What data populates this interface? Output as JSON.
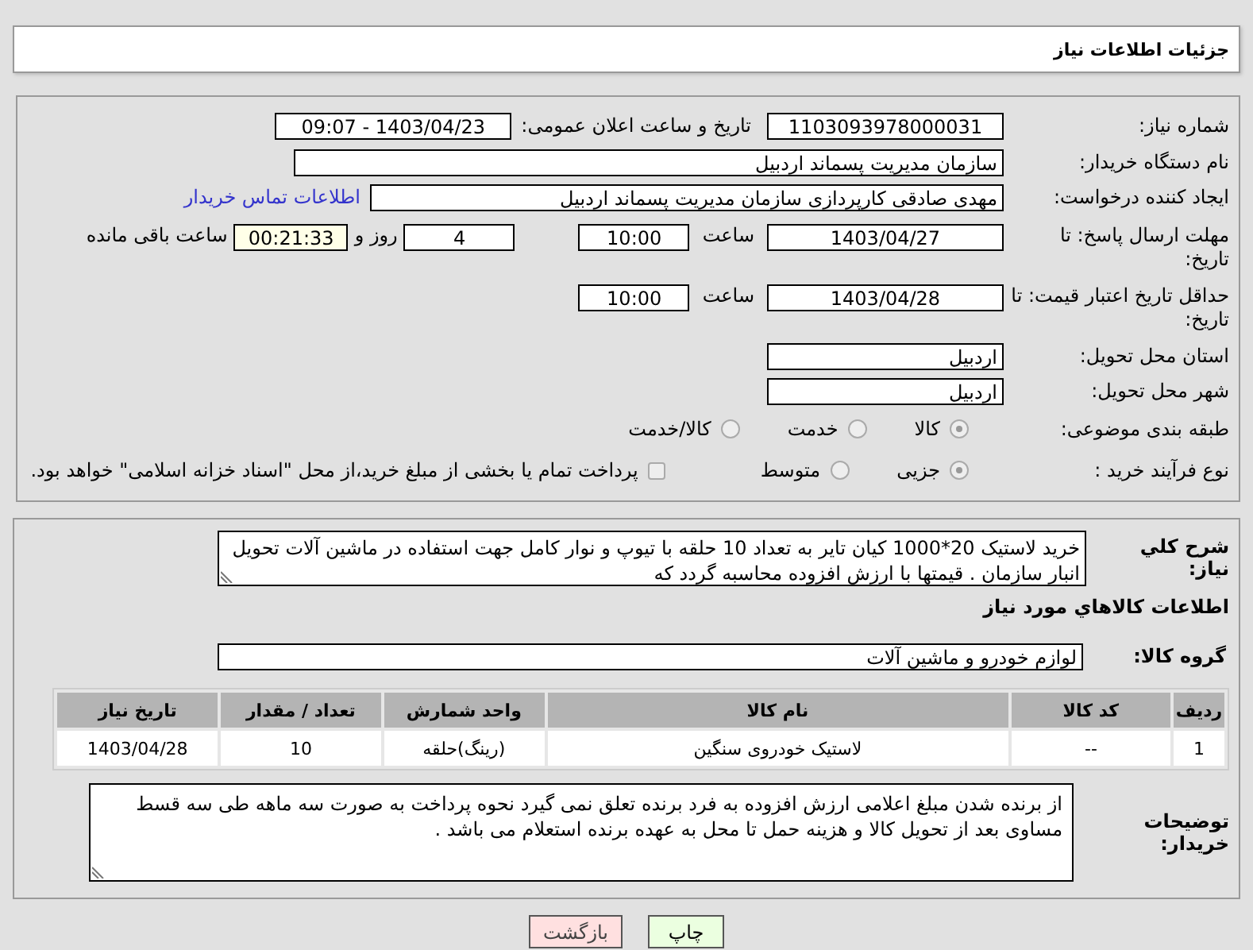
{
  "header": {
    "title": "جزئیات اطلاعات نیاز"
  },
  "need_number": {
    "label": "شماره نیاز:",
    "value": "1103093978000031"
  },
  "announce_datetime": {
    "label": "تاریخ و ساعت اعلان عمومی:",
    "value": "1403/04/23 - 09:07"
  },
  "buyer_org": {
    "label": "نام دستگاه خریدار:",
    "value": "سازمان مدیریت پسماند اردبیل"
  },
  "requester": {
    "label": "ایجاد کننده درخواست:",
    "value": "مهدی صادقی کارپردازی سازمان مدیریت پسماند اردبیل",
    "link": "اطلاعات تماس خریدار"
  },
  "response_deadline": {
    "label": "مهلت ارسال پاسخ: تا تاریخ:",
    "date": "1403/04/27",
    "time_label": "ساعت",
    "time": "10:00",
    "days": "4",
    "days_label": "روز و",
    "remaining": "00:21:33",
    "remaining_label": "ساعت باقی مانده"
  },
  "price_validity": {
    "label": "حداقل تاریخ اعتبار قیمت: تا تاریخ:",
    "date": "1403/04/28",
    "time_label": "ساعت",
    "time": "10:00"
  },
  "province": {
    "label": "استان محل تحویل:",
    "value": "اردبیل"
  },
  "city": {
    "label": "شهر محل تحویل:",
    "value": "اردبیل"
  },
  "category": {
    "label": "طبقه بندی موضوعی:",
    "options": [
      {
        "label": "کالا",
        "selected": true
      },
      {
        "label": "خدمت",
        "selected": false
      },
      {
        "label": "کالا/خدمت",
        "selected": false
      }
    ]
  },
  "purchase_type": {
    "label": "نوع فرآیند خرید :",
    "options": [
      {
        "label": "جزیی",
        "selected": true
      },
      {
        "label": "متوسط",
        "selected": false
      }
    ],
    "treasury": {
      "label": "پرداخت تمام یا بخشی از مبلغ خرید،از محل \"اسناد خزانه اسلامی\" خواهد بود.",
      "checked": false
    }
  },
  "description": {
    "label": "شرح کلي نیاز:",
    "value": "خرید لاستیک 20*1000 کیان تایر به تعداد 10 حلقه با تیوپ و نوار کامل جهت استفاده در ماشین آلات تحویل انبار سازمان . قیمتها با ارزش افزوده محاسبه گردد که"
  },
  "goods_heading": "اطلاعات کالاهاي مورد نیاز",
  "goods_group": {
    "label": "گروه کالا:",
    "value": "لوازم خودرو و ماشین آلات"
  },
  "table": {
    "columns": [
      "ردیف",
      "کد کالا",
      "نام کالا",
      "واحد شمارش",
      "تعداد / مقدار",
      "تاریخ نیاز"
    ],
    "rows": [
      [
        "1",
        "--",
        "لاستیک خودروی سنگین",
        "(رینگ)حلقه",
        "10",
        "1403/04/28"
      ]
    ]
  },
  "buyer_notes": {
    "label": "توضیحات خریدار:",
    "value": "از برنده شدن مبلغ اعلامی ارزش افزوده به فرد برنده تعلق نمی گیرد نحوه پرداخت به صورت سه ماهه طی سه قسط مساوی بعد از تحویل کالا و هزینه حمل تا محل به عهده برنده استعلام می باشد ."
  },
  "buttons": [
    {
      "label": "چاپ",
      "kind": "print"
    },
    {
      "label": "بازگشت",
      "kind": "back"
    }
  ]
}
